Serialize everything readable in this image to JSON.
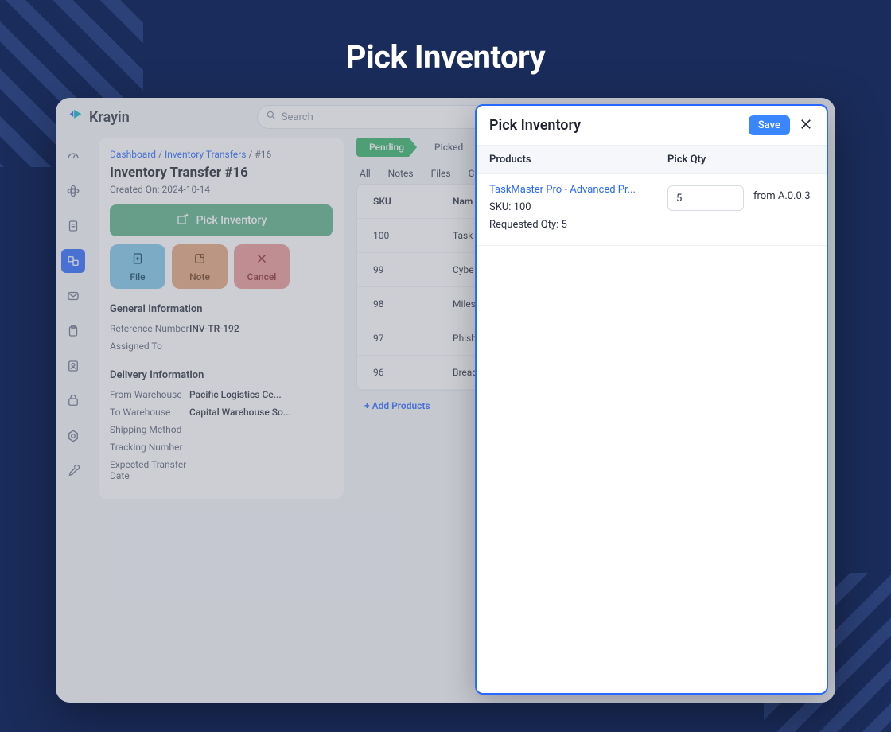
{
  "hero_title": "Pick Inventory",
  "brand": "Krayin",
  "search": {
    "placeholder": "Search"
  },
  "breadcrumbs": {
    "a": "Dashboard",
    "b": "Inventory Transfers",
    "c": "#16"
  },
  "page": {
    "title": "Inventory Transfer #16",
    "created_label": "Created On:",
    "created_on": "2024-10-14"
  },
  "actions": {
    "pick": "Pick Inventory",
    "file": "File",
    "note": "Note",
    "cancel": "Cancel"
  },
  "general": {
    "heading": "General Information",
    "ref_label": "Reference Number",
    "ref_value": "INV-TR-192",
    "assigned_label": "Assigned To",
    "assigned_value": ""
  },
  "delivery": {
    "heading": "Delivery Information",
    "from_label": "From Warehouse",
    "from_value": "Pacific Logistics Ce...",
    "to_label": "To Warehouse",
    "to_value": "Capital Warehouse So...",
    "ship_label": "Shipping Method",
    "track_label": "Tracking Number",
    "expect_label": "Expected Transfer Date"
  },
  "status": {
    "pending": "Pending",
    "picked": "Picked"
  },
  "tabs": {
    "all": "All",
    "notes": "Notes",
    "files": "Files",
    "c": "C"
  },
  "table": {
    "sku_head": "SKU",
    "name_head": "Nam",
    "rows": [
      {
        "sku": "100",
        "name": "Task"
      },
      {
        "sku": "99",
        "name": "Cybe"
      },
      {
        "sku": "98",
        "name": "Miles"
      },
      {
        "sku": "97",
        "name": "Phish"
      },
      {
        "sku": "96",
        "name": "Breac"
      }
    ],
    "add": "+ Add Products"
  },
  "drawer": {
    "title": "Pick Inventory",
    "save": "Save",
    "col_products": "Products",
    "col_qty": "Pick Qty",
    "item": {
      "name": "TaskMaster Pro - Advanced Pr...",
      "sku_line": "SKU: 100",
      "req_line": "Requested Qty: 5",
      "qty_value": "5",
      "from": "from A.0.0.3"
    }
  }
}
